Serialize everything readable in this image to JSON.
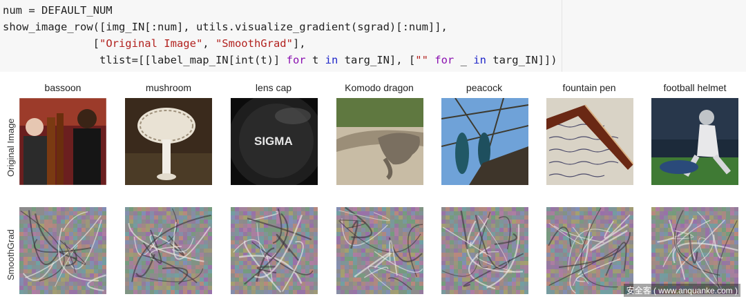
{
  "code": {
    "line1": "num = DEFAULT_NUM",
    "line2": "show_image_row([img_IN[:num], utils.visualize_gradient(sgrad)[:num]],",
    "line3_indent": "              [",
    "line3_str1": "\"Original Image\"",
    "line3_sep": ", ",
    "line3_str2": "\"SmoothGrad\"",
    "line3_end": "],",
    "line4_a": "               tlist=[[label_map_IN[int(t)] ",
    "line4_for1": "for",
    "line4_b": " t ",
    "line4_in1": "in",
    "line4_c": " targ_IN], [",
    "line4_str": "\"\"",
    "line4_for2": " for",
    "line4_d": " _ ",
    "line4_in2": "in",
    "line4_e": " targ_IN]])"
  },
  "figure": {
    "row_labels": [
      "Original Image",
      "SmoothGrad"
    ],
    "columns": [
      {
        "title": "bassoon",
        "image": "photo: orchestra players with bassoon"
      },
      {
        "title": "mushroom",
        "image": "photo: white mushroom"
      },
      {
        "title": "lens cap",
        "image": "photo: black SIGMA lens cap",
        "image_text": "SIGMA"
      },
      {
        "title": "Komodo dragon",
        "image": "photo: komodo dragon on sand"
      },
      {
        "title": "peacock",
        "image": "photo: peacocks on a branch"
      },
      {
        "title": "fountain pen",
        "image": "photo: fountain pen on handwritten letter"
      },
      {
        "title": "football helmet",
        "image": "photo: football players"
      }
    ]
  },
  "watermark": "安全客 ( www.anquanke.com )"
}
